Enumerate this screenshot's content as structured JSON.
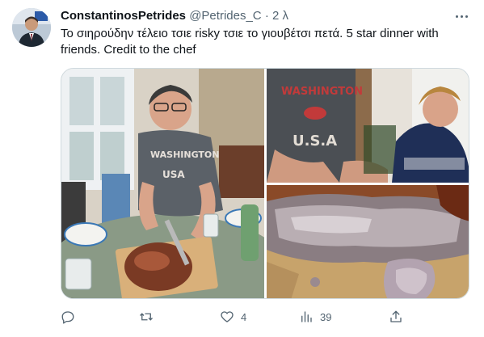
{
  "tweet": {
    "author_name": "ConstantinosPetrides",
    "author_handle": "@Petrides_C",
    "separator": "·",
    "time": "2 λ",
    "text_line1": "Το σιηρούδην τέλειο τσιε  risky τσιε το γιουβέτσι πετά. 5 star dinner with",
    "text_line2": "friends. Credit to the chef",
    "more_icon": "ellipsis-icon"
  },
  "media": {
    "photos": [
      {
        "name": "dinner-table-photo",
        "shirt_text_1": "WASHINGTON",
        "shirt_text_2": "USA"
      },
      {
        "name": "guests-photo",
        "shirt_text_1": "WASHINGTON",
        "shirt_text_2": "U.S.A"
      },
      {
        "name": "meat-closeup-photo"
      }
    ]
  },
  "actions": {
    "reply": {
      "icon": "reply-icon",
      "count": ""
    },
    "retweet": {
      "icon": "retweet-icon",
      "count": ""
    },
    "like": {
      "icon": "heart-icon",
      "count": "4"
    },
    "views": {
      "icon": "views-chart-icon",
      "count": "39"
    },
    "share": {
      "icon": "share-icon",
      "count": ""
    }
  },
  "colors": {
    "text_primary": "#0f1419",
    "text_secondary": "#536471",
    "border": "#cfd9de"
  }
}
